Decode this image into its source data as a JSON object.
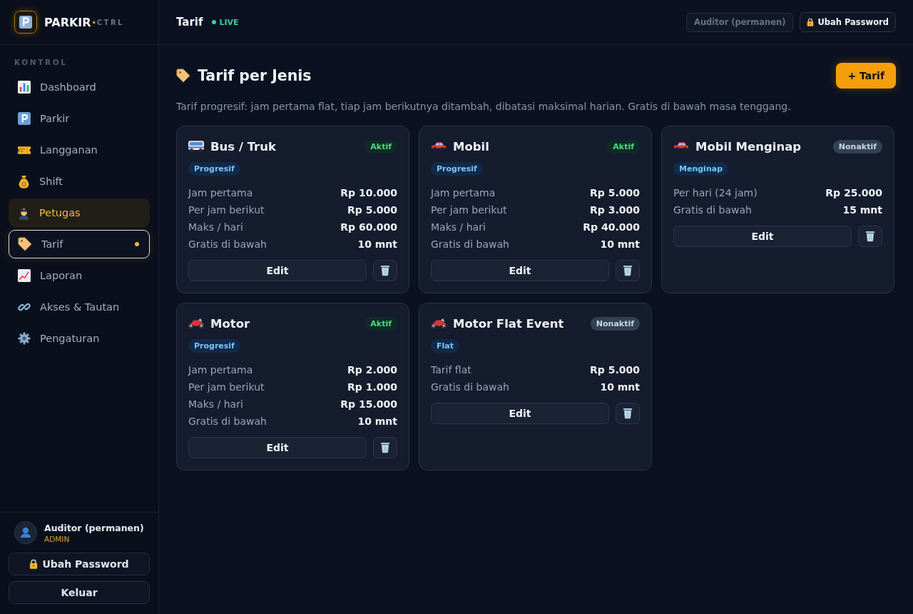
{
  "sidebar": {
    "brand": {
      "name": "PARKIR",
      "separator": "·",
      "suffix": "CTRL"
    },
    "section_label": "KONTROL",
    "nav": [
      {
        "label": "Dashboard",
        "selected": false,
        "highlighted": false
      },
      {
        "label": "Parkir",
        "selected": false,
        "highlighted": false
      },
      {
        "label": "Langganan",
        "selected": false,
        "highlighted": false
      },
      {
        "label": "Shift",
        "selected": false,
        "highlighted": false
      },
      {
        "label": "Petugas",
        "selected": false,
        "highlighted": true
      },
      {
        "label": "Tarif",
        "selected": true,
        "highlighted": false
      },
      {
        "label": "Laporan",
        "selected": false,
        "highlighted": false
      },
      {
        "label": "Akses & Tautan",
        "selected": false,
        "highlighted": false
      },
      {
        "label": "Pengaturan",
        "selected": false,
        "highlighted": false
      }
    ],
    "user": {
      "name": "Auditor (permanen)",
      "role": "ADMIN"
    },
    "buttons": [
      {
        "label": "Ubah Password",
        "kind": "password"
      },
      {
        "label": "Keluar",
        "kind": "logout"
      }
    ]
  },
  "header": {
    "title": "Tarif",
    "live_label": "LIVE",
    "user_chip": "Auditor (permanen)",
    "password_button": "Ubah Password"
  },
  "page": {
    "title": "Tarif per Jenis",
    "add_button": "+ Tarif",
    "description": "Tarif progresif: jam pertama flat, tiap jam berikutnya ditambah, dibatasi maksimal harian. Gratis di bawah masa tenggang."
  },
  "cards": [
    {
      "name": "Bus / Truk",
      "status": "Aktif",
      "active": true,
      "type": "Progresif",
      "rows": [
        {
          "label": "Jam pertama",
          "value": "Rp 10.000"
        },
        {
          "label": "Per jam berikut",
          "value": "Rp 5.000"
        },
        {
          "label": "Maks / hari",
          "value": "Rp 60.000"
        },
        {
          "label": "Gratis di bawah",
          "value": "10 mnt"
        }
      ],
      "edit_button": "Edit"
    },
    {
      "name": "Mobil",
      "status": "Aktif",
      "active": true,
      "type": "Progresif",
      "rows": [
        {
          "label": "Jam pertama",
          "value": "Rp 5.000"
        },
        {
          "label": "Per jam berikut",
          "value": "Rp 3.000"
        },
        {
          "label": "Maks / hari",
          "value": "Rp 40.000"
        },
        {
          "label": "Gratis di bawah",
          "value": "10 mnt"
        }
      ],
      "edit_button": "Edit"
    },
    {
      "name": "Mobil Menginap",
      "status": "Nonaktif",
      "active": false,
      "type": "Menginap",
      "rows": [
        {
          "label": "Per hari (24 jam)",
          "value": "Rp 25.000"
        },
        {
          "label": "Gratis di bawah",
          "value": "15 mnt"
        }
      ],
      "edit_button": "Edit"
    },
    {
      "name": "Motor",
      "status": "Aktif",
      "active": true,
      "type": "Progresif",
      "rows": [
        {
          "label": "Jam pertama",
          "value": "Rp 2.000"
        },
        {
          "label": "Per jam berikut",
          "value": "Rp 1.000"
        },
        {
          "label": "Maks / hari",
          "value": "Rp 15.000"
        },
        {
          "label": "Gratis di bawah",
          "value": "10 mnt"
        }
      ],
      "edit_button": "Edit"
    },
    {
      "name": "Motor Flat Event",
      "status": "Nonaktif",
      "active": false,
      "type": "Flat",
      "rows": [
        {
          "label": "Tarif flat",
          "value": "Rp 5.000"
        },
        {
          "label": "Gratis di bawah",
          "value": "10 mnt"
        }
      ],
      "edit_button": "Edit"
    }
  ]
}
